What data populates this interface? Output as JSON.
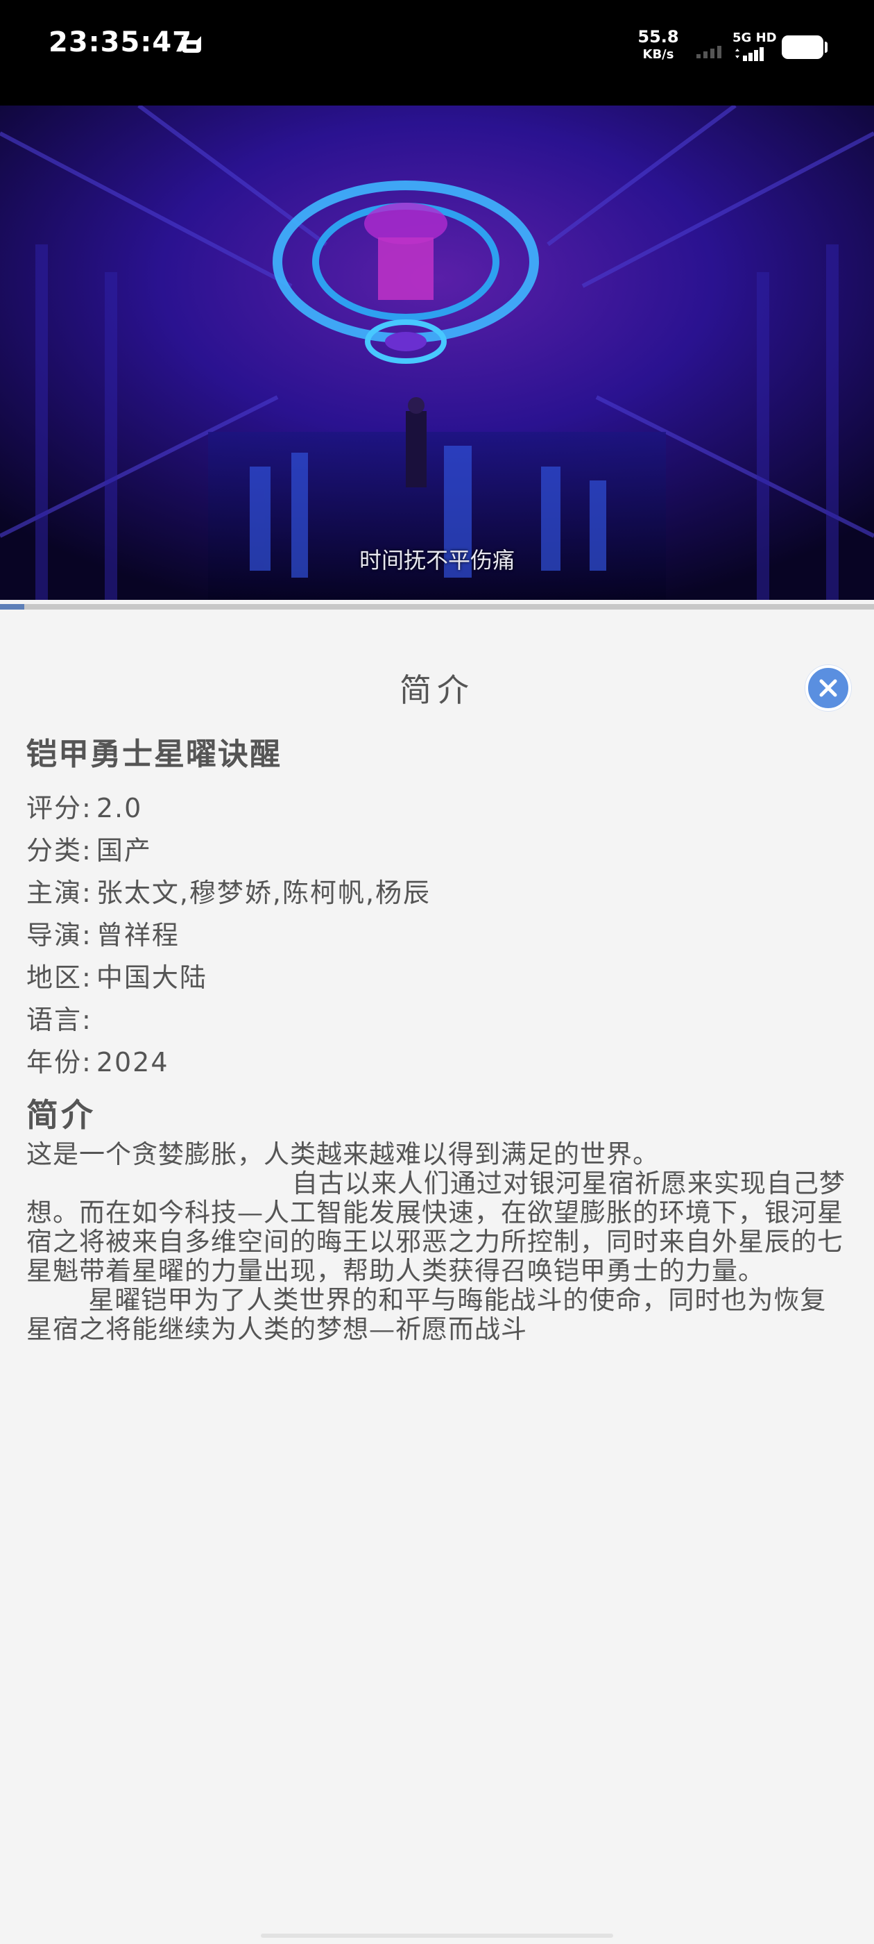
{
  "status_bar": {
    "time": "23:35:47",
    "net_speed_value": "55.8",
    "net_speed_unit": "KB/s",
    "network": "5G HD"
  },
  "video": {
    "subtitle": "时间抚不平伤痛",
    "progress": 0.028
  },
  "panel": {
    "title": "简介",
    "close_label": "close"
  },
  "movie": {
    "title": "铠甲勇士星曜诀醒",
    "rating_label": "评分:",
    "rating": "2.0",
    "category_label": "分类:",
    "category": "国产",
    "cast_label": "主演:",
    "cast": "张太文,穆梦娇,陈柯帆,杨辰",
    "director_label": "导演:",
    "director": "曾祥程",
    "region_label": "地区:",
    "region": "中国大陆",
    "language_label": "语言:",
    "language": "",
    "year_label": "年份:",
    "year": "2024"
  },
  "synopsis": {
    "heading": "简介",
    "text": "这是一个贪婪膨胀，人类越来越难以得到满足的世界。\n                              自古以来人们通过对银河星宿祈愿来实现自己梦想。而在如今科技—人工智能发展快速，在欲望膨胀的环境下，银河星宿之将被来自多维空间的晦王以邪恶之力所控制，同时来自外星辰的七星魁带着星曜的力量出现，帮助人类获得召唤铠甲勇士的力量。\n       星曜铠甲为了人类世界的和平与晦能战斗的使命，同时也为恢复星宿之将能继续为人类的梦想—祈愿而战斗"
  }
}
